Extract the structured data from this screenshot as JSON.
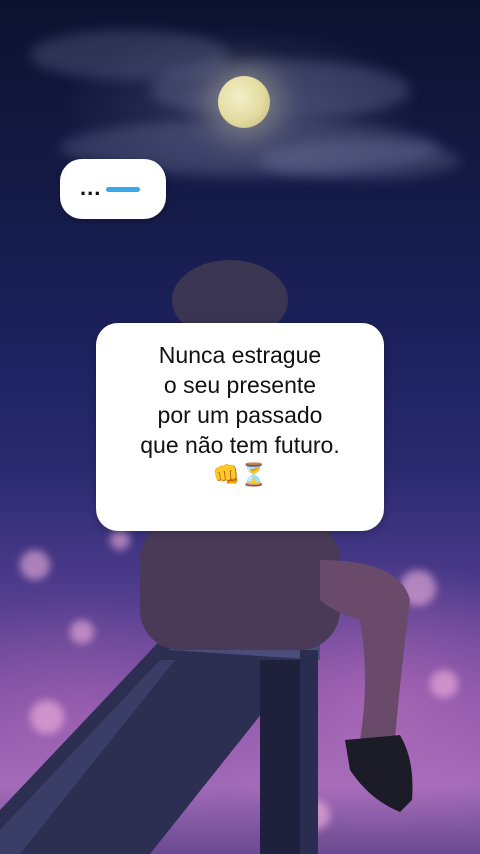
{
  "story": {
    "background_description_colors": {
      "sky_top": "#0d1230",
      "sky_mid": "#1d2260",
      "city_glow": "#a06ab8"
    },
    "small_bubble": {
      "text": "...",
      "cursor_color": "#3aa8e6"
    },
    "quote_card": {
      "lines": [
        "Nunca estrague",
        "o seu presente",
        "por um passado",
        "que não tem futuro."
      ],
      "emojis": "👊⏳"
    }
  }
}
